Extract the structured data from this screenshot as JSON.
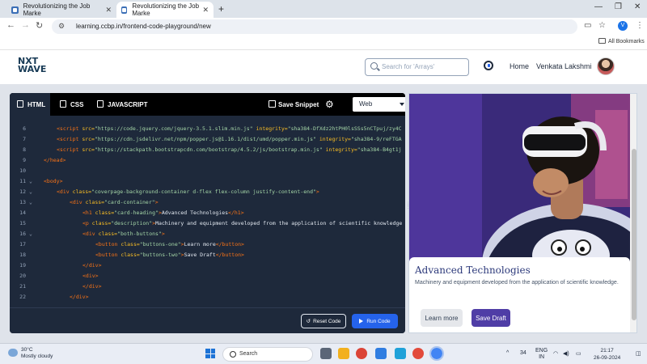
{
  "browser": {
    "tabs": [
      {
        "title": "Revolutionizing the Job Marke"
      },
      {
        "title": "Revolutionizing the Job Marke"
      }
    ],
    "url": "learning.ccbp.in/frontend-code-playground/new",
    "profile_initial": "V",
    "bookmarks_label": "All Bookmarks"
  },
  "header": {
    "logo_line1": "NXT",
    "logo_line2": "WAVE",
    "search_placeholder": "Search for 'Arrays'",
    "home_label": "Home",
    "user_name": "Venkata Lakshmi"
  },
  "editor": {
    "tabs": [
      {
        "label": "HTML",
        "icon": "html5-icon"
      },
      {
        "label": "CSS",
        "icon": "css3-icon"
      },
      {
        "label": "JAVASCRIPT",
        "icon": "js-icon"
      }
    ],
    "save_label": "Save Snippet",
    "view_select": "Web",
    "reset_label": "Reset Code",
    "run_label": "Run Code",
    "lines": [
      {
        "n": "6",
        "fold": "",
        "indent": 2,
        "segs": [
          [
            "hl",
            "<script "
          ],
          [
            "at",
            "src="
          ],
          [
            "st",
            "\"https://code.jquery.com/jquery-3.5.1.slim.min.js\""
          ],
          [
            "at",
            " integrity="
          ],
          [
            "st",
            "\"sha384-DfXdz2htPH0lsSSs5nCTpuj/zy4C"
          ]
        ]
      },
      {
        "n": "7",
        "fold": "",
        "indent": 2,
        "segs": [
          [
            "hl",
            "<script "
          ],
          [
            "at",
            "src="
          ],
          [
            "st",
            "\"https://cdn.jsdelivr.net/npm/popper.js@1.16.1/dist/umd/popper.min.js\""
          ],
          [
            "at",
            " integrity="
          ],
          [
            "st",
            "\"sha384-9/reFTGA"
          ]
        ]
      },
      {
        "n": "8",
        "fold": "",
        "indent": 2,
        "segs": [
          [
            "hl",
            "<script "
          ],
          [
            "at",
            "src="
          ],
          [
            "st",
            "\"https://stackpath.bootstrapcdn.com/bootstrap/4.5.2/js/bootstrap.min.js\""
          ],
          [
            "at",
            " integrity="
          ],
          [
            "st",
            "\"sha384-B4gt1j"
          ]
        ]
      },
      {
        "n": "9",
        "fold": "",
        "indent": 0,
        "segs": [
          [
            "hl",
            "</head>"
          ]
        ]
      },
      {
        "n": "10",
        "fold": "",
        "indent": 0,
        "segs": []
      },
      {
        "n": "11",
        "fold": "⌄",
        "indent": 0,
        "segs": [
          [
            "hl",
            "<body>"
          ]
        ]
      },
      {
        "n": "12",
        "fold": "⌄",
        "indent": 2,
        "segs": [
          [
            "hl",
            "<div "
          ],
          [
            "at",
            "class="
          ],
          [
            "st",
            "\"coverpage-background-container d-flex flex-column justify-content-end\""
          ],
          [
            "hl",
            ">"
          ]
        ]
      },
      {
        "n": "13",
        "fold": "⌄",
        "indent": 4,
        "segs": [
          [
            "hl",
            "<div "
          ],
          [
            "at",
            "class="
          ],
          [
            "st",
            "\"card-container\""
          ],
          [
            "hl",
            ">"
          ]
        ]
      },
      {
        "n": "14",
        "fold": "",
        "indent": 6,
        "segs": [
          [
            "hl",
            "<h1 "
          ],
          [
            "at",
            "class="
          ],
          [
            "st",
            "\"card-heading\""
          ],
          [
            "hl",
            ">"
          ],
          [
            "pl",
            "Advanced Technologies"
          ],
          [
            "hl",
            "</h1>"
          ]
        ]
      },
      {
        "n": "15",
        "fold": "",
        "indent": 6,
        "segs": [
          [
            "hl",
            "<p "
          ],
          [
            "at",
            "class="
          ],
          [
            "st",
            "\"description\""
          ],
          [
            "hl",
            ">"
          ],
          [
            "pl",
            "Machinery and equipment developed from the application of scientific knowledge"
          ]
        ]
      },
      {
        "n": "16",
        "fold": "⌄",
        "indent": 6,
        "segs": [
          [
            "hl",
            "<div "
          ],
          [
            "at",
            "class="
          ],
          [
            "st",
            "\"both-buttons\""
          ],
          [
            "hl",
            ">"
          ]
        ]
      },
      {
        "n": "17",
        "fold": "",
        "indent": 8,
        "segs": [
          [
            "hl",
            "<button "
          ],
          [
            "at",
            "class="
          ],
          [
            "st",
            "\"buttons-one\""
          ],
          [
            "hl",
            ">"
          ],
          [
            "pl",
            "Learn more"
          ],
          [
            "hl",
            "</button>"
          ]
        ]
      },
      {
        "n": "18",
        "fold": "",
        "indent": 8,
        "segs": [
          [
            "hl",
            "<button "
          ],
          [
            "at",
            "class="
          ],
          [
            "st",
            "\"buttons-two\""
          ],
          [
            "hl",
            ">"
          ],
          [
            "pl",
            "Save Draft"
          ],
          [
            "hl",
            "</button>"
          ]
        ]
      },
      {
        "n": "19",
        "fold": "",
        "indent": 6,
        "segs": [
          [
            "hl",
            "</div>"
          ]
        ]
      },
      {
        "n": "20",
        "fold": "",
        "indent": 6,
        "segs": [
          [
            "hl",
            "<div>"
          ]
        ]
      },
      {
        "n": "21",
        "fold": "",
        "indent": 6,
        "segs": [
          [
            "hl",
            "</div>"
          ]
        ]
      },
      {
        "n": "22",
        "fold": "",
        "indent": 4,
        "segs": [
          [
            "hl",
            "</div>"
          ]
        ]
      }
    ]
  },
  "preview": {
    "card_heading": "Advanced Technologies",
    "card_description": "Machinery and equipment developed from the application of scientific knowledge.",
    "button_one": "Learn more",
    "button_two": "Save Draft"
  },
  "taskbar": {
    "temperature": "30°C",
    "weather": "Mostly cloudy",
    "search_label": "Search",
    "badge_count": "34",
    "lang_line1": "ENG",
    "lang_line2": "IN",
    "time": "21:17",
    "date": "26-09-2024"
  }
}
